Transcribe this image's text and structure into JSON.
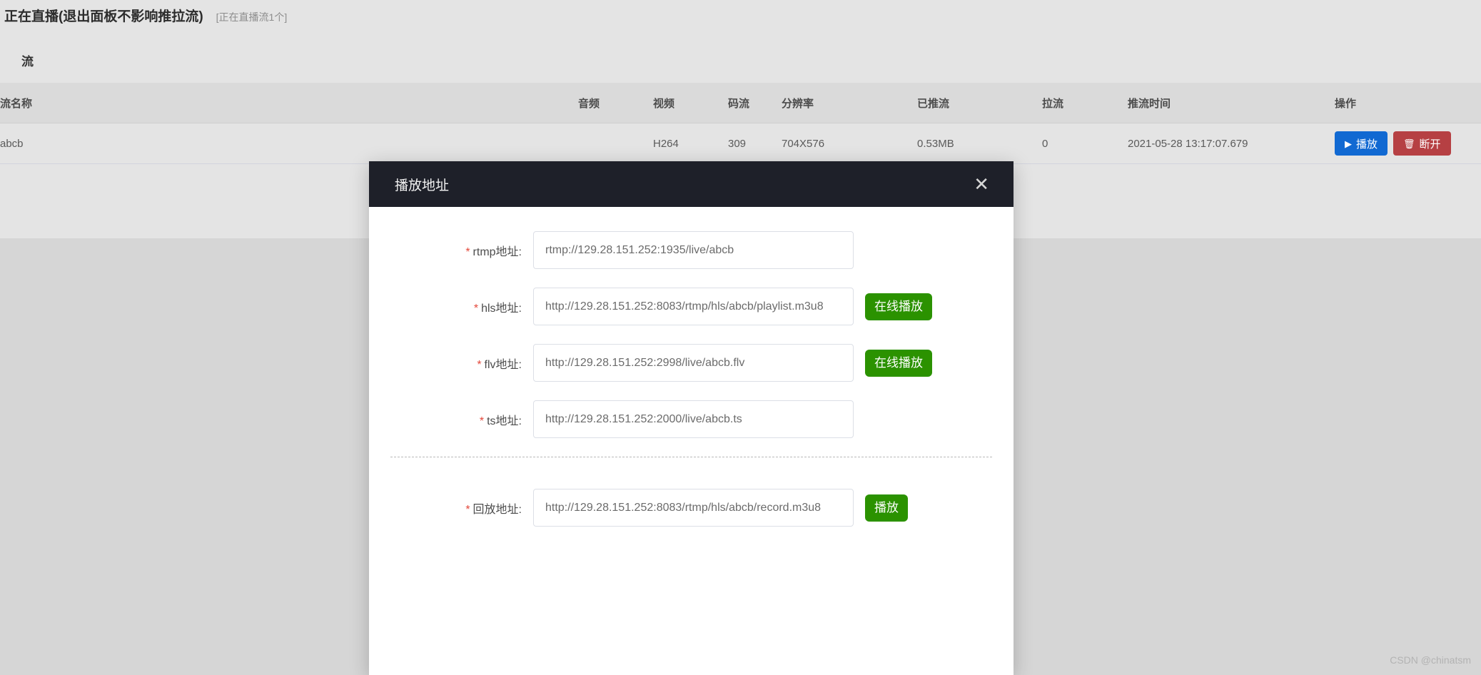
{
  "header": {
    "title": "正在直播(退出面板不影响推拉流)",
    "count_label": "[正在直播流1个]"
  },
  "stream_panel": {
    "title": "流",
    "columns": {
      "name": "流名称",
      "audio": "音频",
      "video": "视频",
      "bitrate": "码流",
      "resolution": "分辨率",
      "pushed": "已推流",
      "pull": "拉流",
      "push_time": "推流时间",
      "operation": "操作"
    },
    "rows": [
      {
        "name": "abcb",
        "audio": "",
        "video": "H264",
        "bitrate": "309",
        "resolution": "704X576",
        "pushed": "0.53MB",
        "pull": "0",
        "push_time": "2021-05-28 13:17:07.679",
        "play_button": "播放",
        "play_icon": "play-triangle-icon",
        "disconnect_button": "断开",
        "disconnect_icon": "trash-icon"
      }
    ]
  },
  "modal": {
    "title": "播放地址",
    "close_icon": "close-icon",
    "fields": [
      {
        "label": "rtmp地址:",
        "value": "rtmp://129.28.151.252:1935/live/abcb",
        "required": "*",
        "action": null
      },
      {
        "label": "hls地址:",
        "value": "http://129.28.151.252:8083/rtmp/hls/abcb/playlist.m3u8",
        "required": "*",
        "action": "在线播放"
      },
      {
        "label": "flv地址:",
        "value": "http://129.28.151.252:2998/live/abcb.flv",
        "required": "*",
        "action": "在线播放"
      },
      {
        "label": "ts地址:",
        "value": "http://129.28.151.252:2000/live/abcb.ts",
        "required": "*",
        "action": null
      }
    ],
    "playback": {
      "label": "回放地址:",
      "value": "http://129.28.151.252:8083/rtmp/hls/abcb/record.m3u8",
      "required": "*",
      "action": "播放"
    }
  },
  "watermark": "CSDN @chinatsm",
  "colors": {
    "accent_blue": "#1169d2",
    "danger_red": "#b64043",
    "green": "#2b9200",
    "modal_header": "#1e2029",
    "required_star": "#e4483b"
  }
}
